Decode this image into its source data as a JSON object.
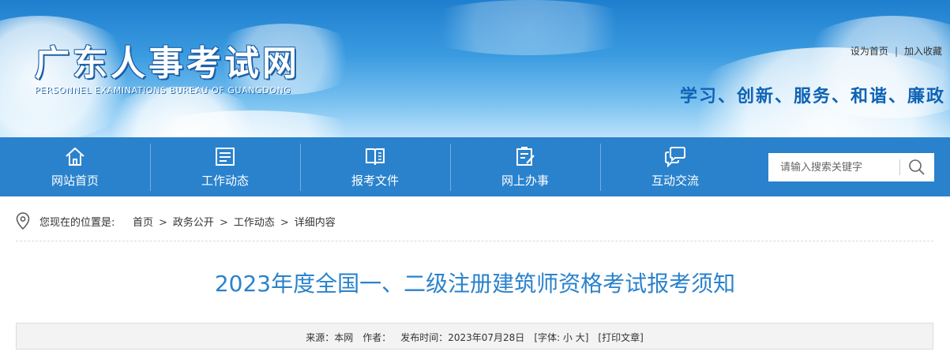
{
  "header": {
    "site_title": "广东人事考试网",
    "site_subtitle": "PERSONNEL EXAMINATIONS BUREAU OF GUANGDONG",
    "set_homepage": "设为首页",
    "add_favorite": "加入收藏",
    "link_separator": "|",
    "slogan": "学习、创新、服务、和谐、廉政"
  },
  "nav": {
    "items": [
      {
        "label": "网站首页",
        "icon": "home-icon"
      },
      {
        "label": "工作动态",
        "icon": "news-icon"
      },
      {
        "label": "报考文件",
        "icon": "document-book-icon"
      },
      {
        "label": "网上办事",
        "icon": "online-service-icon"
      },
      {
        "label": "互动交流",
        "icon": "chat-bubbles-icon"
      }
    ],
    "search_placeholder": "请输入搜索关键字"
  },
  "breadcrumb": {
    "lead": "您现在的位置是:",
    "items": [
      "首页",
      "政务公开",
      "工作动态",
      "详细内容"
    ],
    "arrow": ">"
  },
  "article": {
    "title": "2023年度全国一、二级注册建筑师资格考试报考须知",
    "meta": {
      "source": "来源：本网",
      "author": "作者：",
      "publish_time": "发布时间：2023年07月28日",
      "font_open": "[字体:",
      "font_small": "小",
      "font_large": "大",
      "font_close": "]",
      "print": "[打印文章]"
    }
  },
  "colors": {
    "nav_bg": "#2a82cc",
    "title_blue": "#2a82cc",
    "slogan_blue": "#0f63b5"
  }
}
